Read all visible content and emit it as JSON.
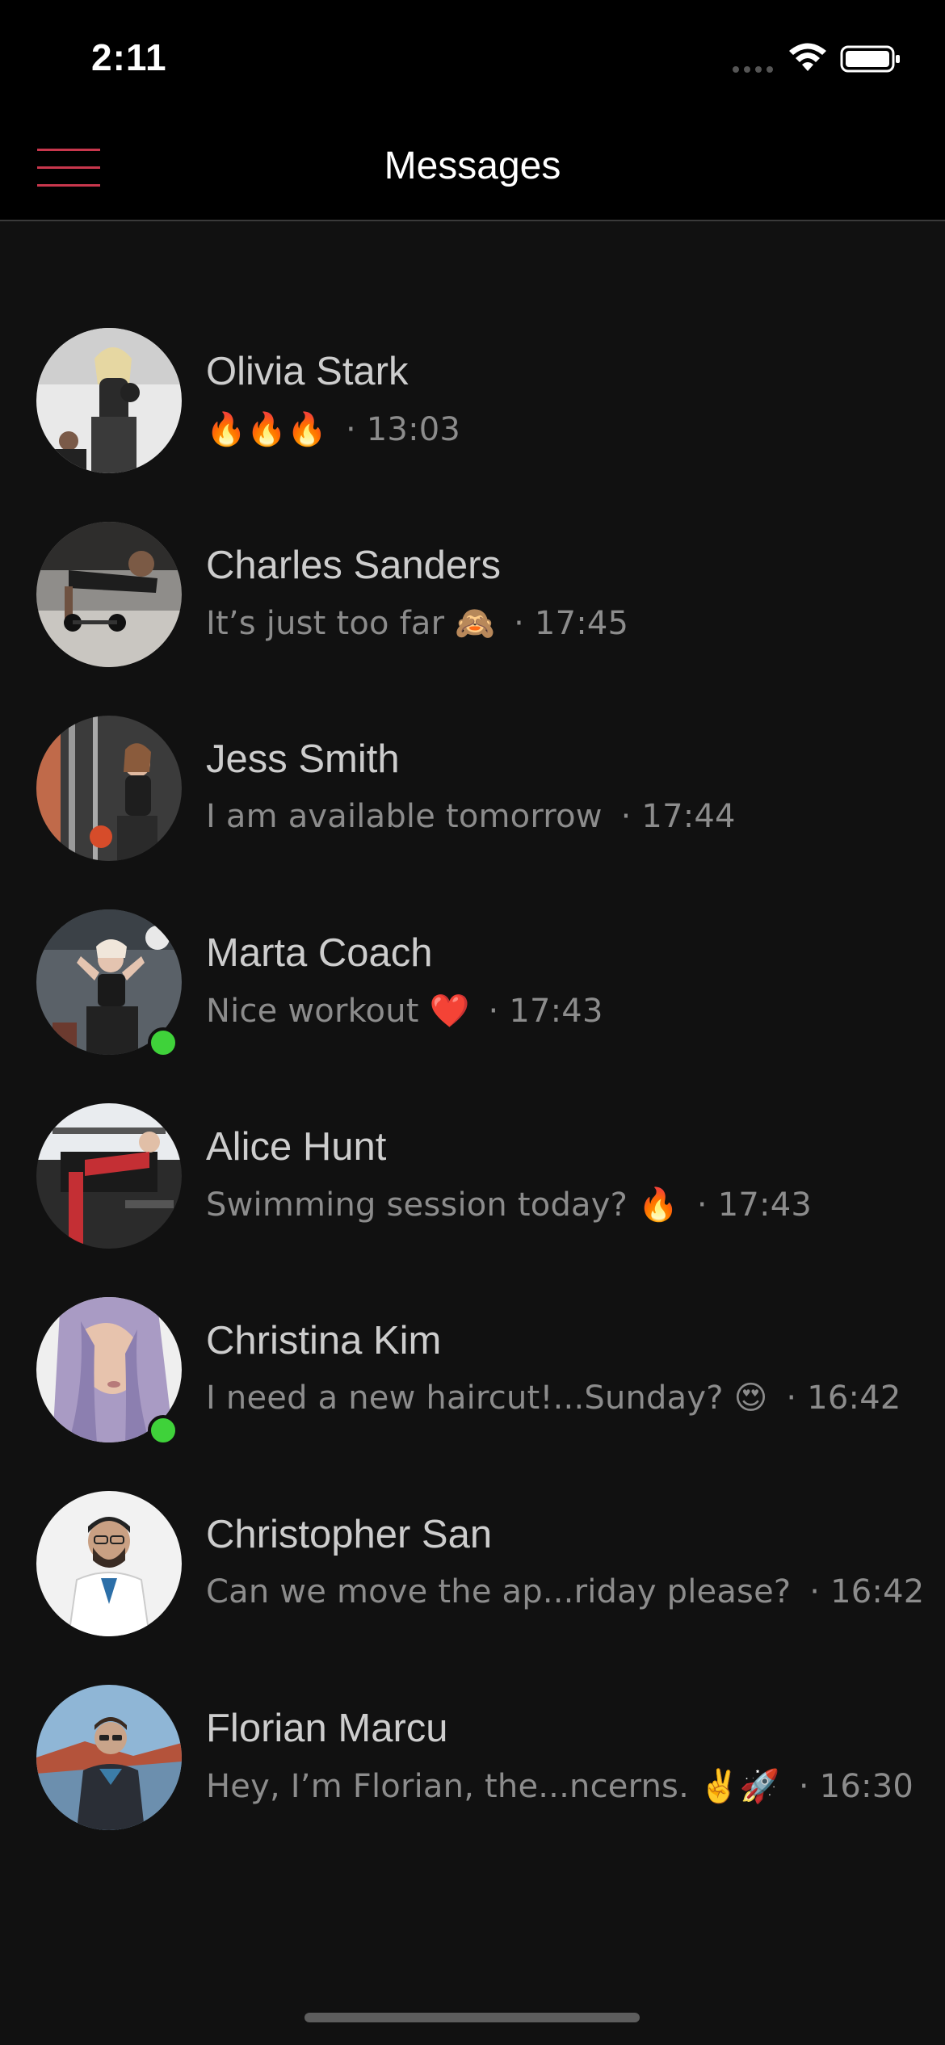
{
  "status_bar": {
    "time": "2:11"
  },
  "header": {
    "title": "Messages",
    "menu_icon": "hamburger-menu-icon",
    "accent_color": "#c8374d"
  },
  "conversations": [
    {
      "name": "Olivia Stark",
      "preview": "🔥🔥🔥",
      "time": "13:03",
      "online": false
    },
    {
      "name": "Charles Sanders",
      "preview": "It’s just too far 🙈",
      "time": "17:45",
      "online": false
    },
    {
      "name": "Jess Smith",
      "preview": "I am available tomorrow",
      "time": "17:44",
      "online": false
    },
    {
      "name": "Marta Coach",
      "preview": "Nice workout ❤️",
      "time": "17:43",
      "online": true
    },
    {
      "name": "Alice Hunt",
      "preview": "Swimming session today? 🔥",
      "time": "17:43",
      "online": false
    },
    {
      "name": "Christina Kim",
      "preview": "I need a new haircut!...Sunday? 😍",
      "time": "16:42",
      "online": true
    },
    {
      "name": "Christopher San",
      "preview": "Can we move the ap...riday please?",
      "time": "16:42",
      "online": false
    },
    {
      "name": "Florian Marcu",
      "preview": "Hey, I’m Florian, the...ncerns. ✌️🚀",
      "time": "16:30",
      "online": false
    }
  ],
  "separator": "·",
  "colors": {
    "background": "#111111",
    "online": "#3fd23a"
  }
}
